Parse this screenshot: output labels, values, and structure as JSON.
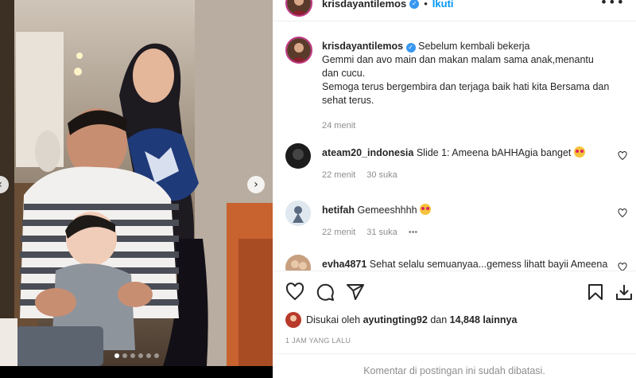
{
  "post": {
    "slide_count": 6,
    "active_slide": 1,
    "next_glyph": "›",
    "prev_glyph": "‹"
  },
  "header": {
    "username": "krisdayantilemos",
    "separator": "•",
    "follow_label": "Ikuti",
    "more_glyph": "•••"
  },
  "caption": {
    "username": "krisdayantilemos",
    "lines": [
      "Sebelum kembali bekerja",
      "Gemmi dan avo main dan makan malam sama anak,menantu",
      "dan cucu.",
      "Semoga terus bergembira dan terjaga baik hati kita Bersama dan",
      "sehat terus."
    ],
    "time": "24 menit"
  },
  "comments": [
    {
      "username": "ateam20_indonesia",
      "text": "Slide 1: Ameena bAHHAgia banget",
      "emoji": "heart-eyes",
      "time": "22 menit",
      "likes": "30 suka",
      "more": ""
    },
    {
      "username": "hetifah",
      "text": "Gemeeshhhh",
      "emoji": "heart-eyes",
      "time": "22 menit",
      "likes": "31 suka",
      "more": "•••"
    },
    {
      "username": "evha4871",
      "text": "Sehat selalu semuanyaa...gemess lihatt bayii Ameena",
      "emoji": "",
      "time": "",
      "likes": "",
      "more": ""
    }
  ],
  "likes": {
    "prefix": "Disukai oleh",
    "user": "ayutingting92",
    "middle": "dan",
    "count": "14,848 lainnya"
  },
  "time_ago": "1 JAM YANG LALU",
  "comments_limited": "Komentar di postingan ini sudah dibatasi.",
  "icons": [
    "heart-icon",
    "comment-icon",
    "share-icon",
    "save-icon",
    "download-icon",
    "verified-icon"
  ],
  "colors": {
    "accent": "#0095f6",
    "verified": "#3897f0",
    "muted": "#8e8e8e",
    "story_ring": "#c13584"
  }
}
